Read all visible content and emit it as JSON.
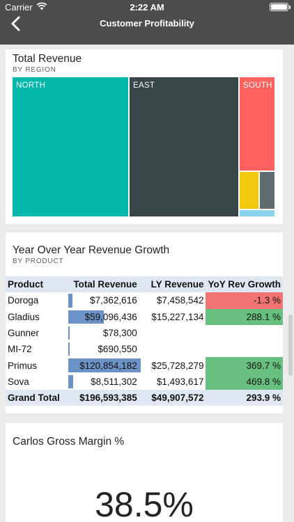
{
  "status_bar": {
    "carrier": "Carrier",
    "time": "2:22 AM"
  },
  "nav": {
    "title": "Customer Profitability"
  },
  "revenue_card": {
    "title": "Total Revenue",
    "subtitle": "BY REGION",
    "regions": [
      {
        "label": "NORTH",
        "color": "#01b8aa"
      },
      {
        "label": "EAST",
        "color": "#374649"
      },
      {
        "label": "SOUTH",
        "color": "#fd625e"
      },
      {
        "label": "",
        "color": "#f2c80f"
      },
      {
        "label": "",
        "color": "#5f6b6d"
      },
      {
        "label": "",
        "color": "#8ad4eb"
      }
    ]
  },
  "growth_card": {
    "title": "Year Over Year Revenue Growth",
    "subtitle": "BY PRODUCT",
    "columns": [
      "Product",
      "Total Revenue",
      "LY Revenue",
      "YoY Rev Growth"
    ],
    "rows": [
      {
        "product": "Doroga",
        "total": "$7,362,616",
        "share": 0.061,
        "ly": "$7,458,542",
        "growth": "-1.3 %",
        "status": "negative"
      },
      {
        "product": "Gladius",
        "total": "$59,096,436",
        "share": 0.489,
        "ly": "$15,227,134",
        "growth": "288.1 %",
        "status": "positive"
      },
      {
        "product": "Gunner",
        "total": "$78,300",
        "share": 0.001,
        "ly": "",
        "growth": "",
        "status": ""
      },
      {
        "product": "MI-72",
        "total": "$690,550",
        "share": 0.006,
        "ly": "",
        "growth": "",
        "status": ""
      },
      {
        "product": "Primus",
        "total": "$120,854,182",
        "share": 1.0,
        "ly": "$25,728,279",
        "growth": "369.7 %",
        "status": "positive"
      },
      {
        "product": "Sova",
        "total": "$8,511,302",
        "share": 0.07,
        "ly": "$1,493,617",
        "growth": "469.8 %",
        "status": "positive"
      }
    ],
    "total": {
      "label": "Grand Total",
      "total": "$196,593,385",
      "ly": "$49,907,572",
      "growth": "293.9 %"
    },
    "colors": {
      "bar": "#6c93c7",
      "negative": "#f47374",
      "positive": "#68c07f",
      "header": "#dde8f2"
    }
  },
  "margin_card": {
    "title": "Carlos Gross Margin %",
    "value": "38.5%"
  }
}
